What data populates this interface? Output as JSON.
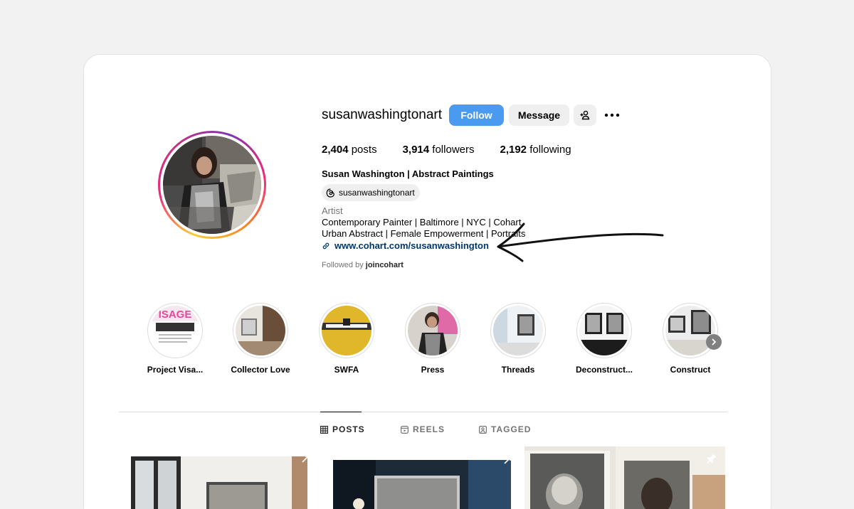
{
  "profile": {
    "username": "susanwashingtonart",
    "follow_label": "Follow",
    "message_label": "Message",
    "posts_count": "2,404",
    "posts_label": "posts",
    "followers_count": "3,914",
    "followers_label": "followers",
    "following_count": "2,192",
    "following_label": "following",
    "full_name": "Susan Washington | Abstract Paintings",
    "threads_handle": "susanwashingtonart",
    "category": "Artist",
    "bio_line1": "Contemporary Painter | Baltimore | NYC | Cohart",
    "bio_line2": "Urban Abstract | Female Empowerment | Portraits",
    "link": "www.cohart.com/susanwashington",
    "followed_by_prefix": "Followed by",
    "followed_by_user": "joincohart"
  },
  "highlights": [
    {
      "label": "Project Visa..."
    },
    {
      "label": "Collector Love"
    },
    {
      "label": "SWFA"
    },
    {
      "label": "Press"
    },
    {
      "label": "Threads"
    },
    {
      "label": "Deconstruct..."
    },
    {
      "label": "Construct"
    }
  ],
  "tabs": [
    {
      "label": "POSTS",
      "icon": "grid-icon",
      "active": true
    },
    {
      "label": "REELS",
      "icon": "reels-icon",
      "active": false
    },
    {
      "label": "TAGGED",
      "icon": "tagged-icon",
      "active": false
    }
  ],
  "colors": {
    "follow_button": "#4a9bf0",
    "link": "#00376b",
    "secondary_text": "#737373"
  }
}
